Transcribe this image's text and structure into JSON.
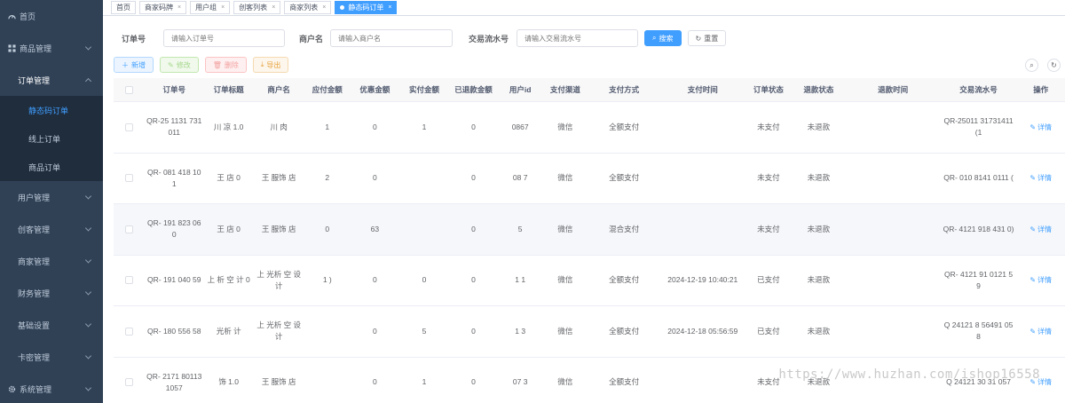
{
  "sidebar": {
    "items": [
      {
        "label": "首页",
        "icon": "dashboard-icon"
      },
      {
        "label": "商品管理",
        "icon": "grid-icon"
      },
      {
        "label": "订单管理",
        "icon": "none",
        "open": true,
        "children": [
          {
            "label": "静态码订单",
            "active": true
          },
          {
            "label": "线上订单"
          },
          {
            "label": "商品订单"
          }
        ]
      },
      {
        "label": "用户管理"
      },
      {
        "label": "创客管理"
      },
      {
        "label": "商家管理"
      },
      {
        "label": "财务管理"
      },
      {
        "label": "基础设置"
      },
      {
        "label": "卡密管理"
      },
      {
        "label": "系统管理",
        "icon": "gear-icon"
      }
    ]
  },
  "tags": [
    {
      "label": "首页",
      "closable": false
    },
    {
      "label": "商家码牌",
      "closable": true
    },
    {
      "label": "用户组",
      "closable": true
    },
    {
      "label": "创客列表",
      "closable": true
    },
    {
      "label": "商家列表",
      "closable": true
    },
    {
      "label": "静态码订单",
      "closable": true,
      "active": true
    }
  ],
  "search": {
    "order_no_label": "订单号",
    "order_no_placeholder": "请输入订单号",
    "merchant_label": "商户名",
    "merchant_placeholder": "请输入商户名",
    "txn_label": "交易流水号",
    "txn_placeholder": "请输入交易流水号",
    "search_label": "搜索",
    "reset_label": "重置"
  },
  "toolbar": {
    "add_label": "新增",
    "edit_label": "修改",
    "delete_label": "删除",
    "export_label": "导出"
  },
  "colors": {
    "sidebar_bg": "#304156",
    "primary": "#409eff"
  },
  "table": {
    "columns": [
      "订单号",
      "订单标题",
      "商户名",
      "应付金额",
      "优惠金额",
      "实付金额",
      "已退款金额",
      "用户id",
      "支付渠道",
      "支付方式",
      "支付时间",
      "订单状态",
      "退款状态",
      "退款时间",
      "交易流水号",
      "操作"
    ],
    "detail_label": "详情",
    "rows": [
      {
        "order_no": "QR-25 1131 731 011",
        "title": "川 凉 1.0",
        "merchant": "川 肉 ",
        "payable": "1",
        "discount": "0",
        "paid": "1",
        "refunded": "0",
        "user_id": "0867",
        "channel": "微信",
        "method": "全额支付",
        "pay_time": "",
        "status": "未支付",
        "refund_status": "未退款",
        "refund_time": "",
        "txn": "QR-25011 31731411 (1"
      },
      {
        "order_no": "QR- 081 418 101",
        "title": "王 店 0",
        "merchant": "王 服饰 店",
        "payable": "2",
        "discount": "0",
        "paid": "",
        "refunded": "0",
        "user_id": "08 7",
        "channel": "微信",
        "method": "全额支付",
        "pay_time": "",
        "status": "未支付",
        "refund_status": "未退款",
        "refund_time": "",
        "txn": "QR- 010 8141 0111 ("
      },
      {
        "order_no": "QR- 191 823 060",
        "title": "王 店 0",
        "merchant": "王 服饰 店",
        "payable": "0",
        "discount": "63",
        "paid": "",
        "refunded": "0",
        "user_id": "5",
        "channel": "微信",
        "method": "混合支付",
        "pay_time": "",
        "status": "未支付",
        "refund_status": "未退款",
        "refund_time": "",
        "txn": "QR- 4121 918 431 0)"
      },
      {
        "order_no": "QR- 191 040 59",
        "title": "上 析 空 计 0",
        "merchant": "上 光析 空 设计",
        "payable": "1 )",
        "discount": "0",
        "paid": "0",
        "refunded": "0",
        "user_id": "1 1",
        "channel": "微信",
        "method": "全额支付",
        "pay_time": "2024-12-19 10:40:21",
        "status": "已支付",
        "refund_status": "未退款",
        "refund_time": "",
        "txn": "QR- 4121 91 0121 59"
      },
      {
        "order_no": "QR- 180 556 58",
        "title": "光析 计 ",
        "merchant": "上 光析 空 设计",
        "payable": "",
        "discount": "0",
        "paid": "5",
        "refunded": "0",
        "user_id": "1 3",
        "channel": "微信",
        "method": "全额支付",
        "pay_time": "2024-12-18 05:56:59",
        "status": "已支付",
        "refund_status": "未退款",
        "refund_time": "",
        "txn": "Q 24121 8 56491 058"
      },
      {
        "order_no": "QR- 2171 801131057",
        "title": "饰 1.0",
        "merchant": "王 服饰 店",
        "payable": "",
        "discount": "0",
        "paid": "1",
        "refunded": "0",
        "user_id": "07 3",
        "channel": "微信",
        "method": "全额支付",
        "pay_time": "",
        "status": "未支付",
        "refund_status": "未退款",
        "refund_time": "",
        "txn": "Q 24121 30 31 057"
      }
    ]
  },
  "watermark": "https://www.huzhan.com/ishop16558"
}
